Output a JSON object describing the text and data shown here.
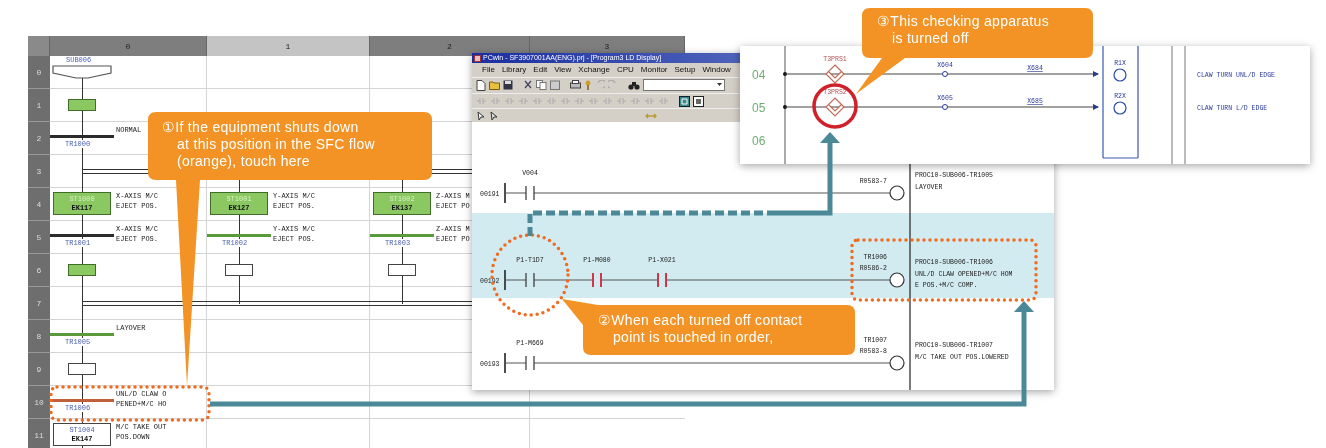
{
  "sfc_sheet": {
    "column_headers": [
      {
        "label": "0",
        "selected": false
      },
      {
        "label": "1",
        "selected": true
      },
      {
        "label": "2",
        "selected": false
      },
      {
        "label": "3",
        "selected": false
      }
    ],
    "rows": [
      {
        "header": "0",
        "cells": [
          {
            "kind": "start",
            "label": "SUB006"
          },
          null,
          null,
          null
        ]
      },
      {
        "header": "1",
        "cells": [
          {
            "kind": "step",
            "active": true
          },
          null,
          null,
          null
        ]
      },
      {
        "header": "2",
        "cells": [
          {
            "kind": "transition",
            "color": "#2b2b2b",
            "label": "TR1000",
            "comment": [
              "NORMAL"
            ]
          },
          null,
          null,
          null
        ]
      },
      {
        "header": "3",
        "cells": [
          {
            "kind": "branch"
          },
          {
            "kind": "branch"
          },
          {
            "kind": "branch"
          },
          null
        ]
      },
      {
        "header": "4",
        "cells": [
          {
            "kind": "step",
            "active": true,
            "label": "ST1000",
            "code": "EK117",
            "comment": [
              "X-AXIS M/C",
              "EJECT POS."
            ]
          },
          {
            "kind": "step",
            "active": true,
            "label": "ST1001",
            "code": "EK127",
            "comment": [
              "Y-AXIS M/C",
              "EJECT POS."
            ]
          },
          {
            "kind": "step",
            "active": true,
            "label": "ST1002",
            "code": "EK137",
            "comment": [
              "Z-AXIS M",
              "EJECT PO"
            ]
          },
          null
        ]
      },
      {
        "header": "5",
        "cells": [
          {
            "kind": "transition",
            "color": "#2b2b2b",
            "label": "TR1001",
            "comment": [
              "X-AXIS M/C",
              "EJECT POS."
            ]
          },
          {
            "kind": "transition",
            "color": "#5a9a3a",
            "label": "TR1002",
            "comment": [
              "Y-AXIS M/C",
              "EJECT POS."
            ]
          },
          {
            "kind": "transition",
            "color": "#5a9a3a",
            "label": "TR1003",
            "comment": [
              "Z-AXIS M",
              "EJECT PO"
            ]
          },
          null
        ]
      },
      {
        "header": "6",
        "cells": [
          {
            "kind": "step",
            "active": true
          },
          {
            "kind": "step",
            "active": false
          },
          {
            "kind": "step",
            "active": false
          },
          null
        ]
      },
      {
        "header": "7",
        "cells": [
          {
            "kind": "branch"
          },
          {
            "kind": "branch"
          },
          {
            "kind": "branch"
          },
          null
        ]
      },
      {
        "header": "8",
        "cells": [
          {
            "kind": "transition",
            "color": "#5a9a3a",
            "label": "TR1005",
            "comment": [
              "LAYOVER"
            ]
          },
          null,
          null,
          null
        ]
      },
      {
        "header": "9",
        "cells": [
          {
            "kind": "step",
            "active": false
          },
          null,
          null,
          null
        ]
      },
      {
        "header": "10",
        "cells": [
          {
            "kind": "transition",
            "color": "#c0603a",
            "label": "TR1006",
            "comment": [
              "UNL/D CLAW O",
              "PENED+M/C HO"
            ]
          },
          null,
          null,
          null
        ]
      },
      {
        "header": "11",
        "cells": [
          {
            "kind": "step",
            "active": false,
            "label": "ST1004",
            "code": "EK147",
            "comment": [
              "M/C TAKE OUT",
              "POS.DOWN"
            ]
          },
          null,
          null,
          null
        ]
      }
    ]
  },
  "ladder_window": {
    "title": "PCwin - SF3907001AA(ENG).prj - [Program3 LD Display]",
    "menu": [
      "File",
      "Library",
      "Edit",
      "View",
      "Xchange",
      "CPU",
      "Monitor",
      "Setup",
      "Window"
    ],
    "rungs": [
      {
        "number": "00191",
        "selected": false,
        "contacts": [
          {
            "label": "V004",
            "off": false
          }
        ],
        "coil_label": "R0583-7",
        "comment": [
          "PROC10-SUB006-TR1005",
          "LAYOVER"
        ]
      },
      {
        "number": "00192",
        "selected": true,
        "contacts": [
          {
            "label": "P1-T1D7",
            "off": false
          },
          {
            "label": "P1-M080",
            "off": true
          },
          {
            "label": "P1-X021",
            "off": true
          }
        ],
        "coil_tag": "TR1006",
        "coil_label": "R0586-2",
        "comment": [
          "PROC10-SUB006-TR1006",
          "UNL/D CLAW OPENED+M/C HOM",
          "E POS.+M/C COMP."
        ]
      },
      {
        "number": "00193",
        "selected": false,
        "contacts": [
          {
            "label": "P1-M669",
            "off": false
          }
        ],
        "coil_tag": "TR1007",
        "coil_label": "R0583-8",
        "comment": [
          "PROC10-SUB006-TR1007",
          "M/C TAKE OUT POS.LOWERED"
        ]
      }
    ]
  },
  "circuit_window": {
    "rows": [
      {
        "number": "04",
        "marked": false,
        "sensor": "T3PRS1",
        "input": "X604",
        "signal": "X684",
        "output": "R1X",
        "comment": "CLAW TURN UNL/D EDGE"
      },
      {
        "number": "05",
        "marked": true,
        "sensor": "T3PRS2",
        "input": "X605",
        "signal": "X685",
        "output": "R2X",
        "comment": "CLAW TURN L/D EDGE"
      },
      {
        "number": "06",
        "marked": false
      }
    ]
  },
  "callouts": [
    {
      "lines": [
        "①If the equipment shuts down",
        "at this position in the SFC flow",
        "(orange), touch here"
      ]
    },
    {
      "lines": [
        "②When each turned off contact",
        "point is touched in order,"
      ]
    },
    {
      "lines": [
        "③This checking apparatus",
        "is turned off"
      ]
    }
  ]
}
